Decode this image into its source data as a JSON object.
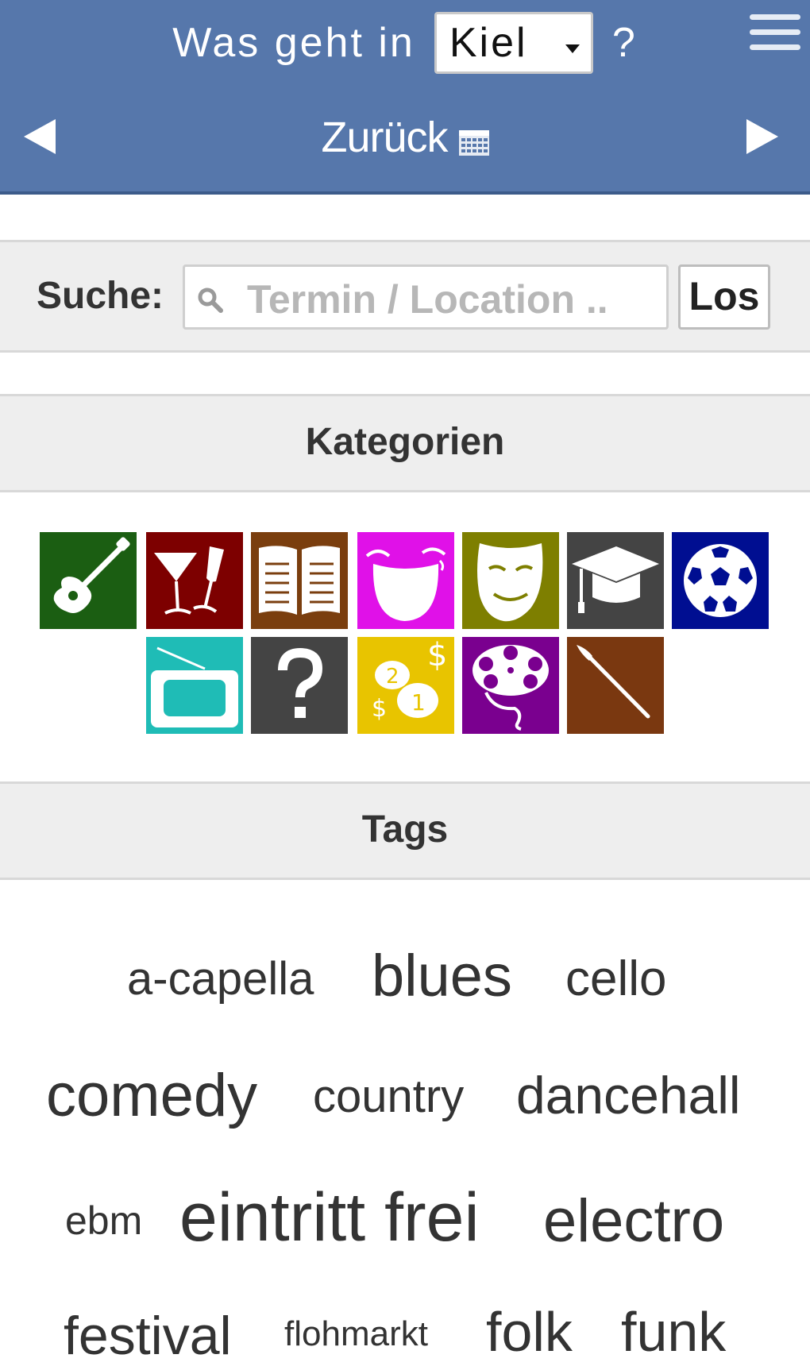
{
  "header": {
    "title_prefix": "Was geht in",
    "city": "Kiel",
    "title_suffix": "?",
    "back_label": "Zurück"
  },
  "search": {
    "label": "Suche:",
    "placeholder": "Termin / Location ..",
    "button_label": "Los"
  },
  "categories": {
    "heading": "Kategorien",
    "items": [
      {
        "icon": "guitar-icon",
        "color": "#1b5e12"
      },
      {
        "icon": "cocktail-glasses-icon",
        "color": "#7d0000"
      },
      {
        "icon": "open-book-icon",
        "color": "#7a3e0e"
      },
      {
        "icon": "laughing-face-icon",
        "color": "#e011e8"
      },
      {
        "icon": "theater-mask-icon",
        "color": "#7e7f00"
      },
      {
        "icon": "graduation-cap-icon",
        "color": "#444444"
      },
      {
        "icon": "soccer-ball-icon",
        "color": "#000e91"
      },
      {
        "icon": "tv-icon",
        "color": "#1fbcb6"
      },
      {
        "icon": "question-mark-icon",
        "color": "#444444"
      },
      {
        "icon": "coins-icon",
        "color": "#e8c400"
      },
      {
        "icon": "film-reel-icon",
        "color": "#7a008f"
      },
      {
        "icon": "paintbrush-icon",
        "color": "#7a3810"
      }
    ]
  },
  "tags": {
    "heading": "Tags",
    "items": [
      "a-capella",
      "blues",
      "cello",
      "comedy",
      "country",
      "dancehall",
      "ebm",
      "eintritt frei",
      "electro",
      "festival",
      "flohmarkt",
      "folk",
      "funk"
    ]
  },
  "colors": {
    "header_bg": "#5677ab",
    "section_bg": "#eeeeee",
    "tag_text": "#333333"
  }
}
